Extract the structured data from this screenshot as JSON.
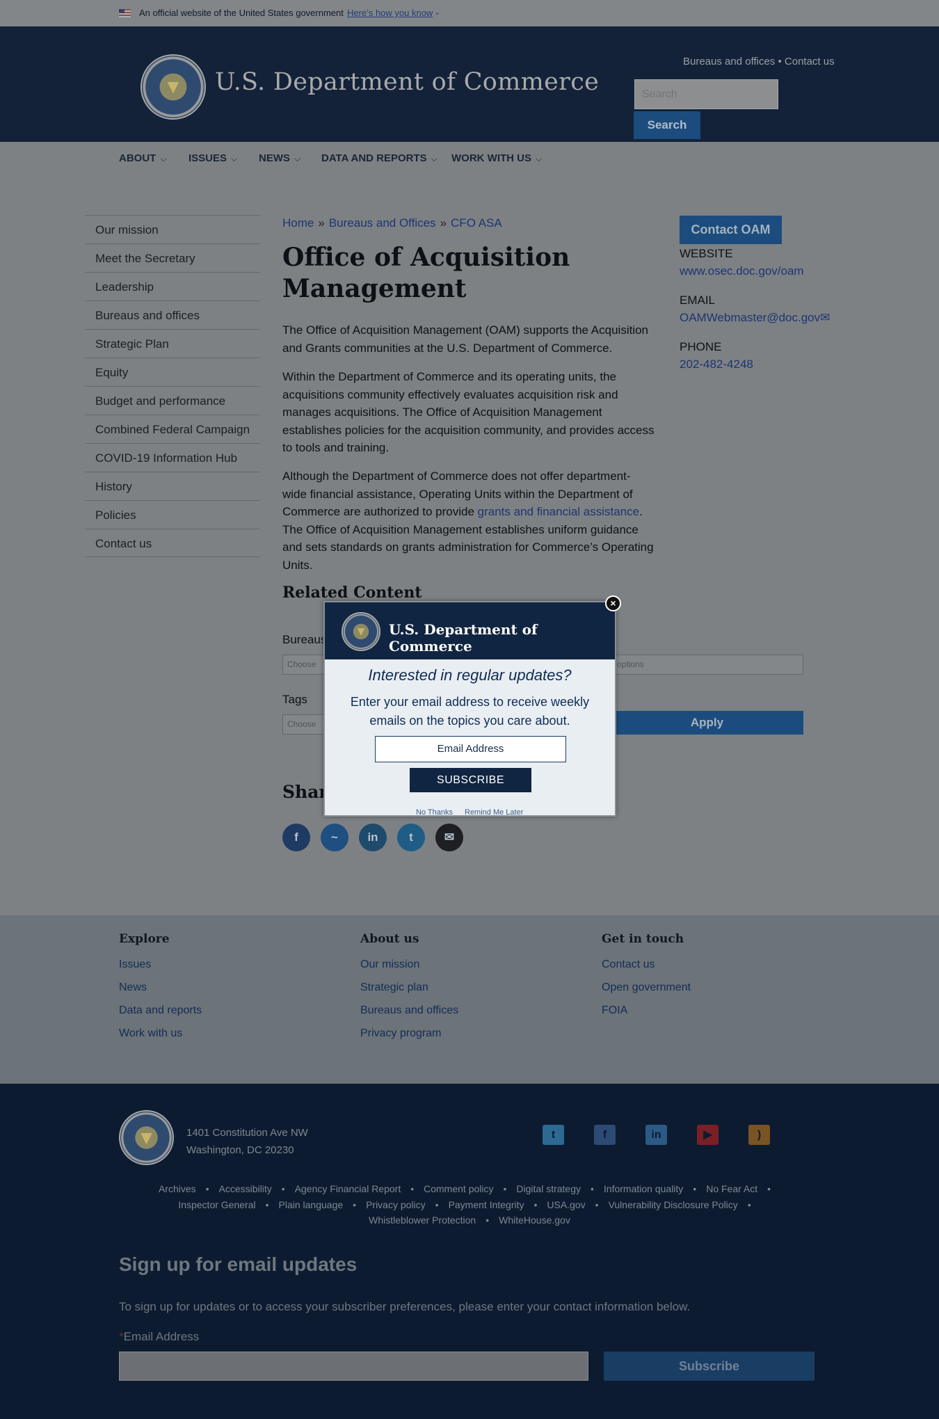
{
  "gov_banner": {
    "official_text": "An official website of the United States government",
    "how_you_know": "Here’s how you know",
    "chevron": "⌄"
  },
  "header": {
    "site_title": "U.S. Department of Commerce",
    "util_bureaus": "Bureaus and offices",
    "util_sep": " • ",
    "util_contact": "Contact us",
    "search_placeholder": "Search",
    "search_button": "Search"
  },
  "main_nav": [
    {
      "label": "ABOUT"
    },
    {
      "label": "ISSUES"
    },
    {
      "label": "NEWS"
    },
    {
      "label": "DATA AND REPORTS"
    },
    {
      "label": "WORK WITH US"
    }
  ],
  "sidebar": [
    {
      "label": "Our mission"
    },
    {
      "label": "Meet the Secretary"
    },
    {
      "label": "Leadership"
    },
    {
      "label": "Bureaus and offices"
    },
    {
      "label": "Strategic Plan"
    },
    {
      "label": "Equity"
    },
    {
      "label": "Budget and performance"
    },
    {
      "label": "Combined Federal Campaign"
    },
    {
      "label": "COVID-19 Information Hub"
    },
    {
      "label": "History"
    },
    {
      "label": "Policies"
    },
    {
      "label": "Contact us"
    }
  ],
  "breadcrumb": {
    "home": "Home",
    "bureaus": "Bureaus and Offices",
    "current": "CFO ASA",
    "sep": "»"
  },
  "page": {
    "title": "Office of Acquisition Management",
    "para1": "The Office of Acquisition Management (OAM) supports the Acquisition and Grants communities at the U.S. Department of Commerce.",
    "para2": "Within the Department of Commerce and its operating units, the acquisitions community effectively evaluates acquisition risk and manages acquisitions. The Office of Acquisition Management establishes policies for the acquisition community, and provides access to tools and training.",
    "para3_before": "Although the Department of Commerce does not offer department-wide financial assistance, Operating Units within the Department of Commerce are authorized to provide ",
    "para3_link": "grants and financial assistance",
    "para3_after": ". The Office of Acquisition Management establishes uniform guidance and sets standards on grants administration for Commerce’s Operating Units.",
    "related_title": "Related Content",
    "bureaus_label": "Bureaus",
    "bureaus_placeholder": "Choose",
    "other_placeholder": "options",
    "tags_label": "Tags",
    "tags_placeholder": "Choose",
    "apply": "Apply",
    "share_title": "Shar"
  },
  "share_icons": [
    {
      "name": "facebook-icon",
      "glyph": "f",
      "color": "#1f3a63"
    },
    {
      "name": "messenger-icon",
      "glyph": "~",
      "color": "#1f4e80"
    },
    {
      "name": "linkedin-icon",
      "glyph": "in",
      "color": "#1e4a6b"
    },
    {
      "name": "twitter-icon",
      "glyph": "t",
      "color": "#1f5c86"
    },
    {
      "name": "email-icon",
      "glyph": "✉",
      "color": "#1d1f22"
    }
  ],
  "right_rail": {
    "contact_button": "Contact OAM",
    "website_label": "WEBSITE",
    "website": "www.osec.doc.gov/oam",
    "email_label": "EMAIL",
    "email": "OAMWebmaster@doc.gov✉",
    "phone_label": "PHONE",
    "phone": "202-482-4248"
  },
  "footer_links": {
    "explore": {
      "title": "Explore",
      "links": [
        "Issues",
        "News",
        "Data and reports",
        "Work with us"
      ]
    },
    "about": {
      "title": "About us",
      "links": [
        "Our mission",
        "Strategic plan",
        "Bureaus and offices",
        "Privacy program"
      ]
    },
    "contact": {
      "title": "Get in touch",
      "links": [
        "Contact us",
        "Open government",
        "FOIA"
      ]
    }
  },
  "footer": {
    "address1": "1401 Constitution Ave NW",
    "address2": "Washington, DC 20230",
    "social": [
      {
        "name": "twitter-icon",
        "glyph": "t",
        "color": "#2c6a94"
      },
      {
        "name": "facebook-icon",
        "glyph": "f",
        "color": "#2c4a74"
      },
      {
        "name": "linkedin-icon",
        "glyph": "in",
        "color": "#2c5a86"
      },
      {
        "name": "youtube-icon",
        "glyph": "▶",
        "color": "#7a1f25"
      },
      {
        "name": "rss-icon",
        "glyph": ")",
        "color": "#7a5424"
      }
    ],
    "legal_row1": [
      "Archives",
      "Accessibility",
      "Agency Financial Report",
      "Comment policy",
      "Digital strategy",
      "Information quality",
      "No Fear Act"
    ],
    "legal_row2": [
      "Inspector General",
      "Plain language",
      "Privacy policy",
      "Payment Integrity",
      "USA.gov",
      "Vulnerability Disclosure Policy"
    ],
    "legal_row3": [
      "Whistleblower Protection",
      "WhiteHouse.gov"
    ],
    "signup_title": "Sign up for email updates",
    "signup_desc": "To sign up for updates or to access your subscriber preferences, please enter your contact information below.",
    "signup_req": "*",
    "signup_label": "Email Address",
    "signup_button": "Subscribe"
  },
  "modal": {
    "title": "U.S. Department of Commerce",
    "headline": "Interested in regular updates?",
    "message": "Enter your email address to receive weekly emails on the topics you care about.",
    "email_placeholder": "Email Address",
    "subscribe": "SUBSCRIBE",
    "no_thanks": "No Thanks",
    "remind": "Remind Me Later",
    "close": "×"
  }
}
